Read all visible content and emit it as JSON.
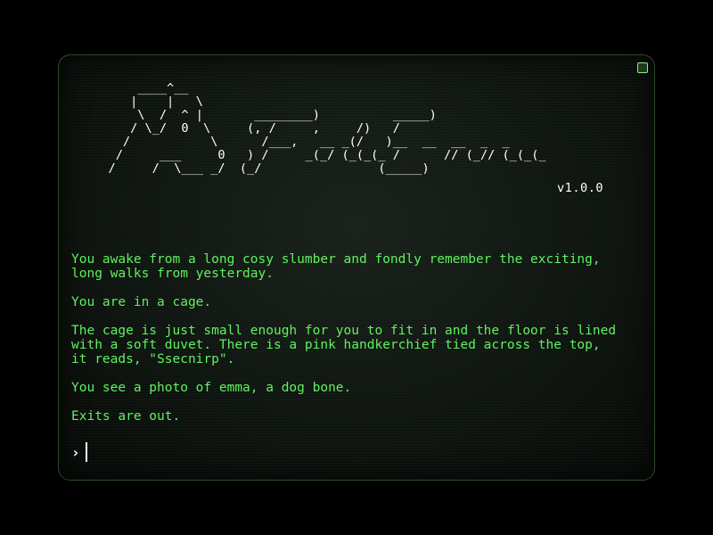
{
  "title_art": {
    "lines": [
      "       ____^__",
      "      |    |   \\",
      "       \\  /  ^ |       ________)          _____)",
      "      / \\_/  0  \\     (, /     ,     /)   /",
      "     /           \\      /___,   __ _(/   )__  __  __  _  _",
      "    /     ___     0   ) /     _(_/ (_(_(_ /      // (_// (_(_(_",
      "   /     /  \\___ _/  (_/                (_____)"
    ]
  },
  "version": "v1.0.0",
  "output": {
    "paragraphs": [
      "You awake from a long cosy slumber and fondly remember the exciting,\nlong walks from yesterday.",
      "You are in a cage.",
      "The cage is just small enough for you to fit in and the floor is lined\nwith a soft duvet. There is a pink handkerchief tied across the top,\nit reads, \"Ssecnirp\".",
      "You see a photo of emma, a dog bone.",
      "Exits are out."
    ]
  },
  "prompt": {
    "icon": "chevron-right-icon",
    "symbol": "›",
    "input_value": ""
  },
  "colors": {
    "text": "#5ff25f",
    "title": "#ffffff",
    "border": "#2e4a2a",
    "background": "#0b100c"
  }
}
